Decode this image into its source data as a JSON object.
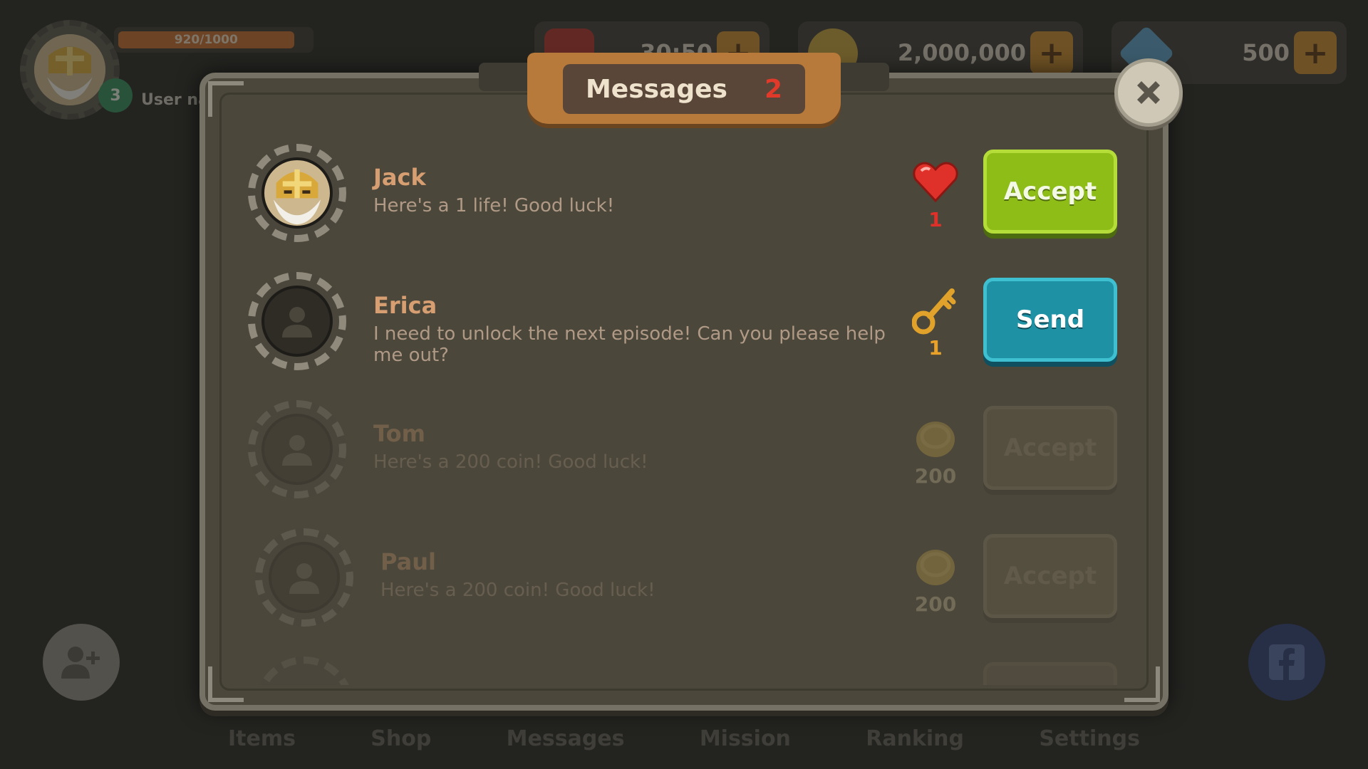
{
  "hud": {
    "xp_label": "920/1000",
    "xp_progress": 0.92,
    "level": "3",
    "username": "User na",
    "lives_timer": "30:50",
    "coins": "2,000,000",
    "gems": "500",
    "plus_symbol": "+"
  },
  "modal": {
    "title": "Messages",
    "count": "2",
    "close_icon": "close-icon"
  },
  "messages": [
    {
      "name": "Jack",
      "text": "Here's a 1 life! Good luck!",
      "reward_icon": "heart-icon",
      "reward_count": "1",
      "reward_color": "#e0302a",
      "action": "Accept",
      "avatar": "knight-avatar"
    },
    {
      "name": "Erica",
      "text": "I need to unlock the next episode!  Can you please help me out?",
      "reward_icon": "key-icon",
      "reward_count": "1",
      "reward_color": "#e8a22a",
      "action": "Send",
      "avatar": "default-avatar"
    },
    {
      "name": "Tom",
      "text": "Here's a 200 coin! Good luck!",
      "reward_icon": "coin-icon",
      "reward_count": "200",
      "reward_color": "#c8a250",
      "action": "Accept",
      "avatar": "default-avatar"
    },
    {
      "name": "Paul",
      "text": "Here's a 200 coin! Good luck!",
      "reward_icon": "coin-icon",
      "reward_count": "200",
      "reward_color": "#c8a250",
      "action": "Accept",
      "avatar": "default-avatar"
    }
  ],
  "bottom_nav": [
    "Items",
    "Shop",
    "Messages",
    "Mission",
    "Ranking",
    "Settings"
  ],
  "colors": {
    "accept_green": "#8fbd17",
    "send_teal": "#1f91a4",
    "title_accent": "#e23a2a",
    "name_color": "#d79e72"
  }
}
